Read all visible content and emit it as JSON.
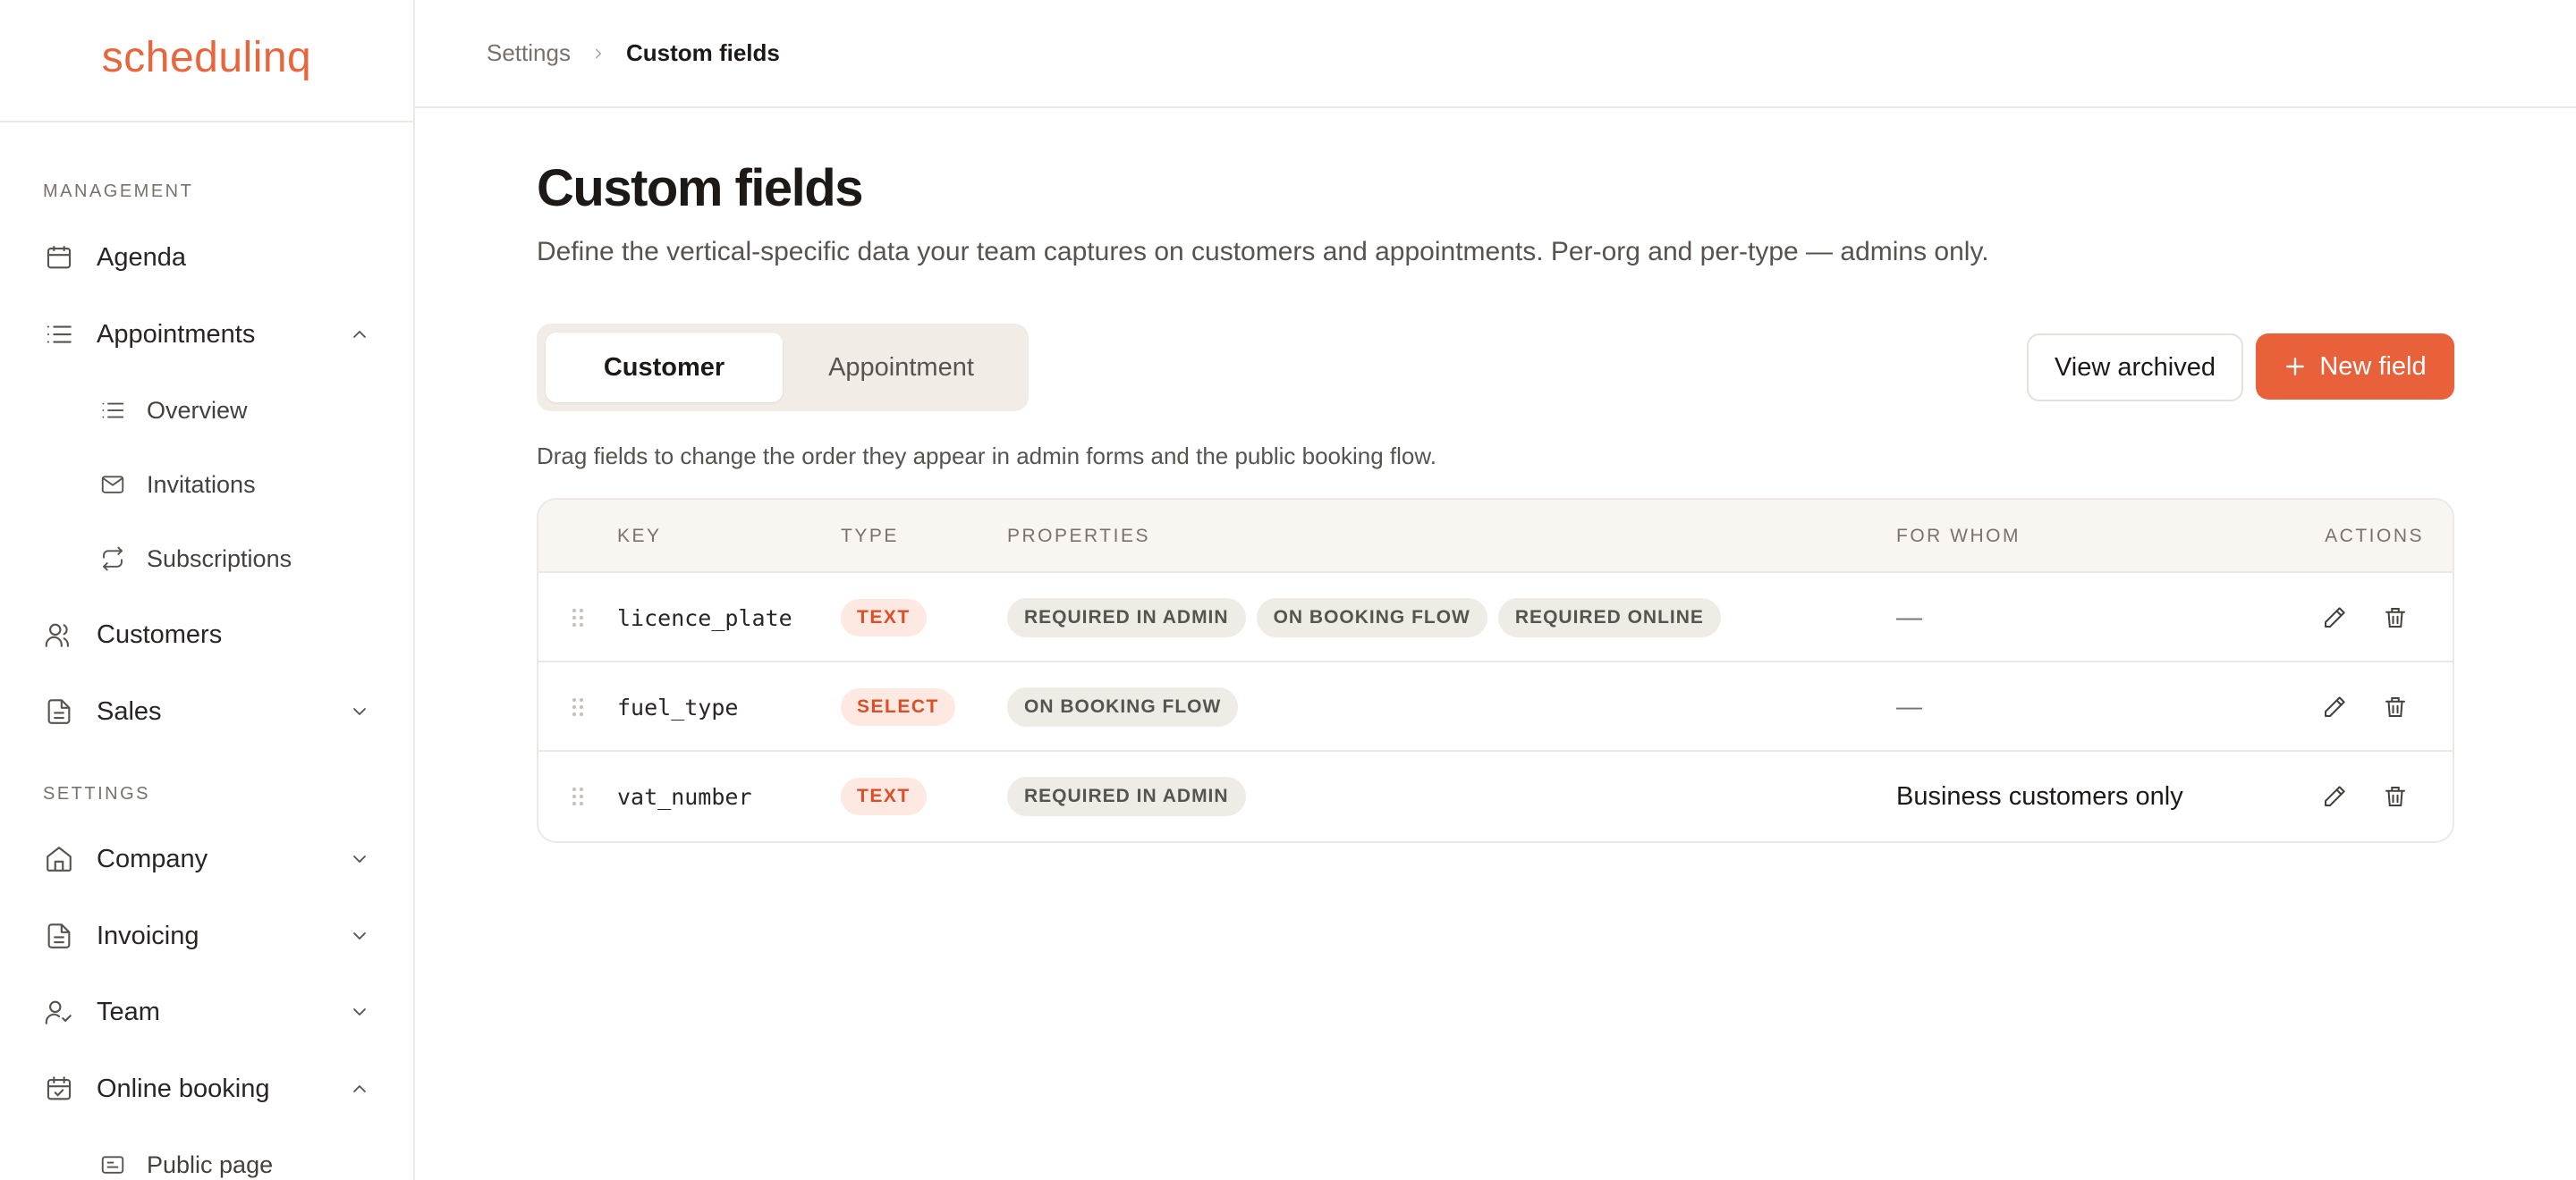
{
  "brand": {
    "name": "schedulinq",
    "accent": "#e8663d"
  },
  "sidebar": {
    "sections": [
      {
        "label": "MANAGEMENT"
      },
      {
        "label": "SETTINGS"
      }
    ],
    "items": [
      {
        "label": "Agenda",
        "icon": "calendar-icon"
      },
      {
        "label": "Appointments",
        "icon": "list-icon",
        "expanded": true
      },
      {
        "label": "Overview",
        "icon": "list-icon"
      },
      {
        "label": "Invitations",
        "icon": "mail-icon"
      },
      {
        "label": "Subscriptions",
        "icon": "repeat-icon"
      },
      {
        "label": "Customers",
        "icon": "users-icon"
      },
      {
        "label": "Sales",
        "icon": "file-icon",
        "expanded": false
      },
      {
        "label": "Company",
        "icon": "home-icon",
        "expanded": false
      },
      {
        "label": "Invoicing",
        "icon": "file-icon",
        "expanded": false
      },
      {
        "label": "Team",
        "icon": "user-check-icon",
        "expanded": false
      },
      {
        "label": "Online booking",
        "icon": "calendar-check-icon",
        "expanded": true
      },
      {
        "label": "Public page",
        "icon": "card-icon"
      }
    ]
  },
  "breadcrumb": {
    "root": "Settings",
    "current": "Custom fields"
  },
  "page": {
    "title": "Custom fields",
    "description": "Define the vertical-specific data your team captures on customers and appointments. Per-org and per-type — admins only.",
    "hint": "Drag fields to change the order they appear in admin forms and the public booking flow."
  },
  "tabs": [
    {
      "label": "Customer",
      "active": true
    },
    {
      "label": "Appointment",
      "active": false
    }
  ],
  "actions": {
    "view_archived": "View archived",
    "new_field": "New field"
  },
  "table": {
    "headers": {
      "key": "KEY",
      "type": "TYPE",
      "properties": "PROPERTIES",
      "for_whom": "FOR WHOM",
      "actions": "ACTIONS"
    },
    "rows": [
      {
        "key": "licence_plate",
        "type": "TEXT",
        "properties": [
          "REQUIRED IN ADMIN",
          "ON BOOKING FLOW",
          "REQUIRED ONLINE"
        ],
        "for_whom": "—"
      },
      {
        "key": "fuel_type",
        "type": "SELECT",
        "properties": [
          "ON BOOKING FLOW"
        ],
        "for_whom": "—"
      },
      {
        "key": "vat_number",
        "type": "TEXT",
        "properties": [
          "REQUIRED IN ADMIN"
        ],
        "for_whom": "Business customers only"
      }
    ]
  }
}
